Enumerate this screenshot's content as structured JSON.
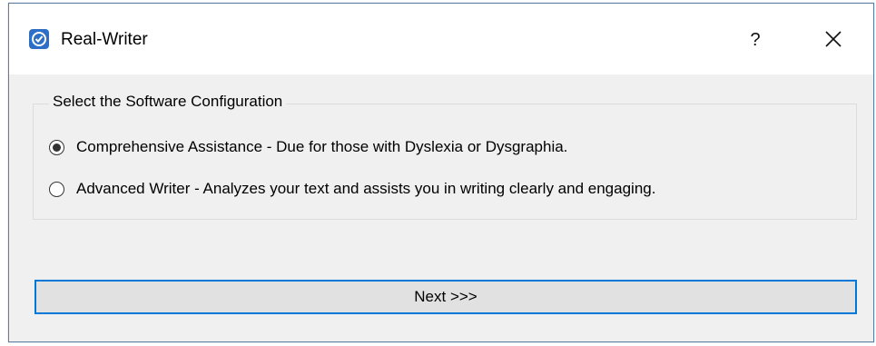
{
  "window": {
    "title": "Real-Writer",
    "help_label": "?",
    "close_icon": "close-icon"
  },
  "group": {
    "title": "Select the Software Configuration",
    "options": [
      {
        "label": "Comprehensive Assistance - Due for those with Dyslexia or Dysgraphia.",
        "selected": true
      },
      {
        "label": "Advanced Writer - Analyzes your text and assists you in writing clearly and engaging.",
        "selected": false
      }
    ]
  },
  "actions": {
    "next_label": "Next >>>"
  },
  "colors": {
    "accent": "#0078d7",
    "app_icon": "#2c6fc4"
  }
}
